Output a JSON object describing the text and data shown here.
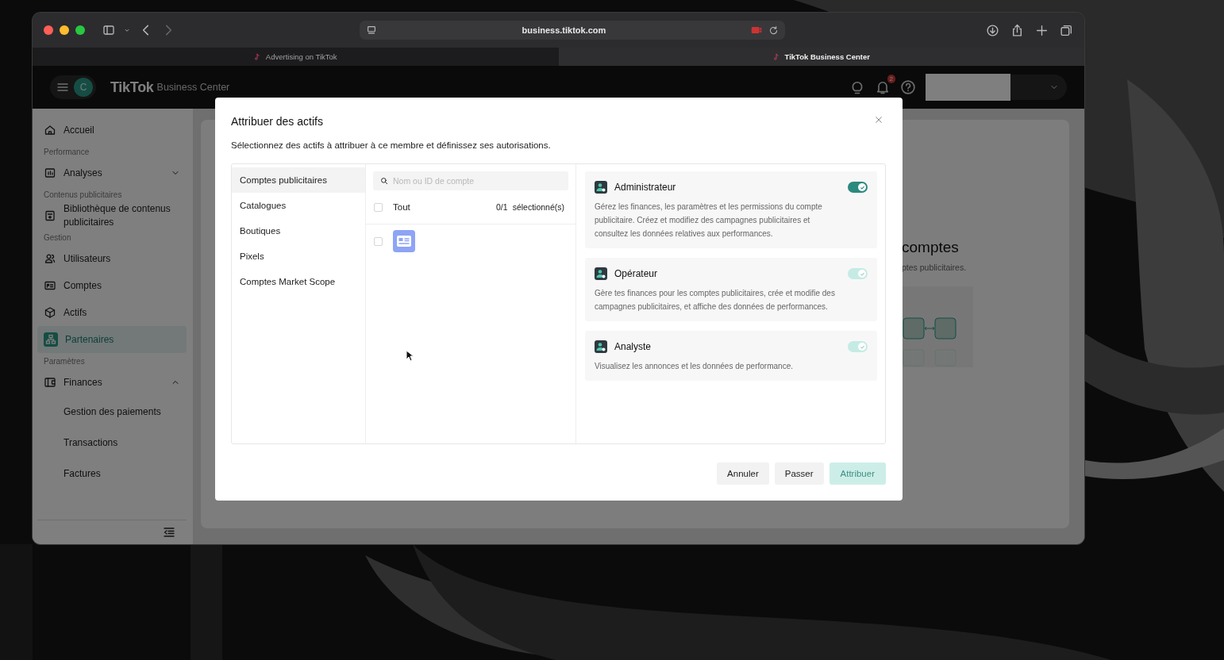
{
  "browser": {
    "address": "business.tiktok.com",
    "tabs": [
      {
        "label": "Advertising on TikTok",
        "selected": false
      },
      {
        "label": "TikTok Business Center",
        "selected": true
      }
    ]
  },
  "header": {
    "avatar": "C",
    "logo": "TikTok",
    "product": "Business Center",
    "notification_count": "2"
  },
  "sidebar": {
    "items": [
      {
        "kind": "item",
        "label": "Accueil",
        "selected": false
      },
      {
        "kind": "section",
        "label": "Performance"
      },
      {
        "kind": "item",
        "label": "Analyses",
        "selected": false,
        "expanded": false
      },
      {
        "kind": "section",
        "label": "Contenus publicitaires"
      },
      {
        "kind": "item",
        "label": "Bibliothèque de contenus publicitaires",
        "selected": false
      },
      {
        "kind": "section",
        "label": "Gestion"
      },
      {
        "kind": "item",
        "label": "Utilisateurs",
        "selected": false
      },
      {
        "kind": "item",
        "label": "Comptes",
        "selected": false
      },
      {
        "kind": "item",
        "label": "Actifs",
        "selected": false
      },
      {
        "kind": "item",
        "label": "Partenaires",
        "selected": true
      },
      {
        "kind": "section",
        "label": "Paramètres"
      },
      {
        "kind": "item",
        "label": "Finances",
        "selected": false,
        "expanded": true,
        "children": [
          {
            "label": "Gestion des paiements",
            "selected": false
          },
          {
            "label": "Transactions",
            "selected": false
          },
          {
            "label": "Factures",
            "selected": false
          }
        ]
      }
    ]
  },
  "background_page": {
    "heading": "comptes",
    "text": "ptes publicitaires."
  },
  "modal": {
    "title": "Attribuer des actifs",
    "subtitle": "Sélectionnez des actifs à attribuer à ce membre et définissez ses autorisations.",
    "categories": [
      {
        "label": "Comptes publicitaires",
        "selected": true
      },
      {
        "label": "Catalogues",
        "selected": false
      },
      {
        "label": "Boutiques",
        "selected": false
      },
      {
        "label": "Pixels",
        "selected": false
      },
      {
        "label": "Comptes Market Scope",
        "selected": false
      }
    ],
    "search": {
      "placeholder": "Nom ou ID de compte"
    },
    "select_all": {
      "label": "Tout",
      "checked": false,
      "count": "0/1",
      "count_label": "sélectionné(s)"
    },
    "accounts": [
      {
        "checked": false
      }
    ],
    "roles": [
      {
        "name": "Administrateur",
        "description": "Gérez les finances, les paramètres et les permissions du compte publicitaire. Créez et modifiez des campagnes publicitaires et consultez les données relatives aux performances.",
        "on": true,
        "disabled": false
      },
      {
        "name": "Opérateur",
        "description": "Gère tes finances pour les comptes publicitaires, crée et modifie des campagnes publicitaires, et affiche des données de performances.",
        "on": true,
        "disabled": true
      },
      {
        "name": "Analyste",
        "description": "Visualisez les annonces et les données de performance.",
        "on": true,
        "disabled": true
      }
    ],
    "buttons": [
      {
        "label": "Annuler",
        "kind": "secondary",
        "disabled": false
      },
      {
        "label": "Passer",
        "kind": "secondary",
        "disabled": false
      },
      {
        "label": "Attribuer",
        "kind": "primary",
        "disabled": true
      }
    ]
  }
}
